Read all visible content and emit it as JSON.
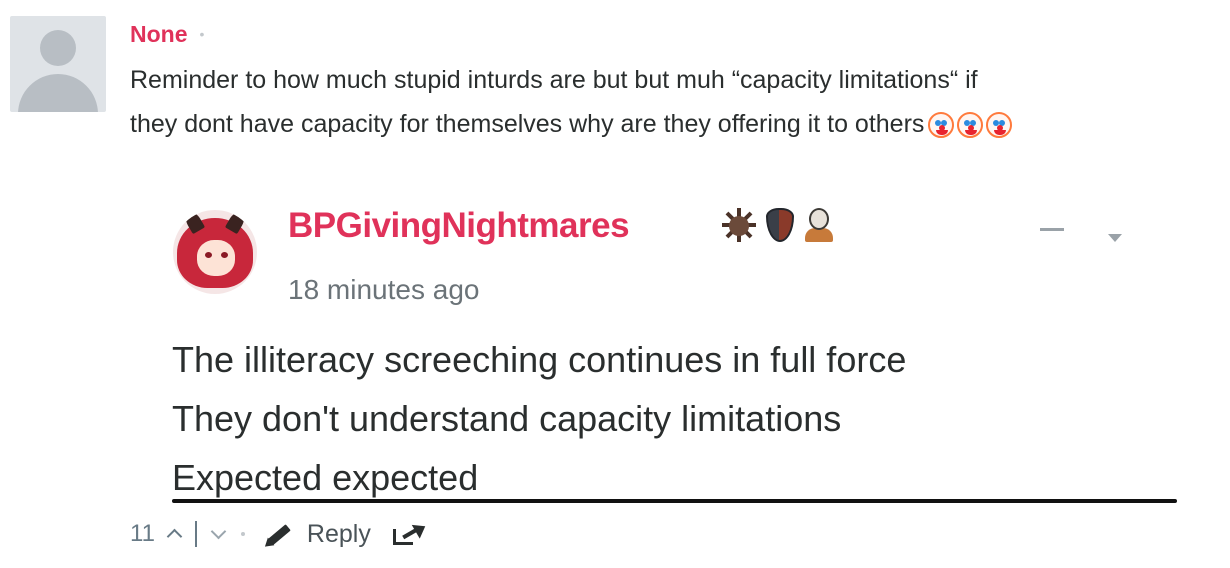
{
  "comment": {
    "author": "None",
    "separator": "•",
    "message_line1": "Reminder to how much stupid inturds are but but muh “capacity limitations“ if",
    "message_line2": "they dont have capacity for themselves why are they offering it to others"
  },
  "embedded": {
    "username": "BPGivingNightmares",
    "timestamp": "18 minutes ago",
    "lines": [
      "The illiteracy screeching continues in full force",
      "They don't understand capacity limitations",
      "Expected expected"
    ],
    "badges": [
      "spiky-badge-icon",
      "shield-badge-icon",
      "mask-badge-icon"
    ]
  },
  "footer": {
    "vote_count": "11",
    "separator": "•",
    "reply_label": "Reply"
  },
  "colors": {
    "author": "#e0325a",
    "text": "#2a2e2e",
    "muted": "#687a86"
  }
}
